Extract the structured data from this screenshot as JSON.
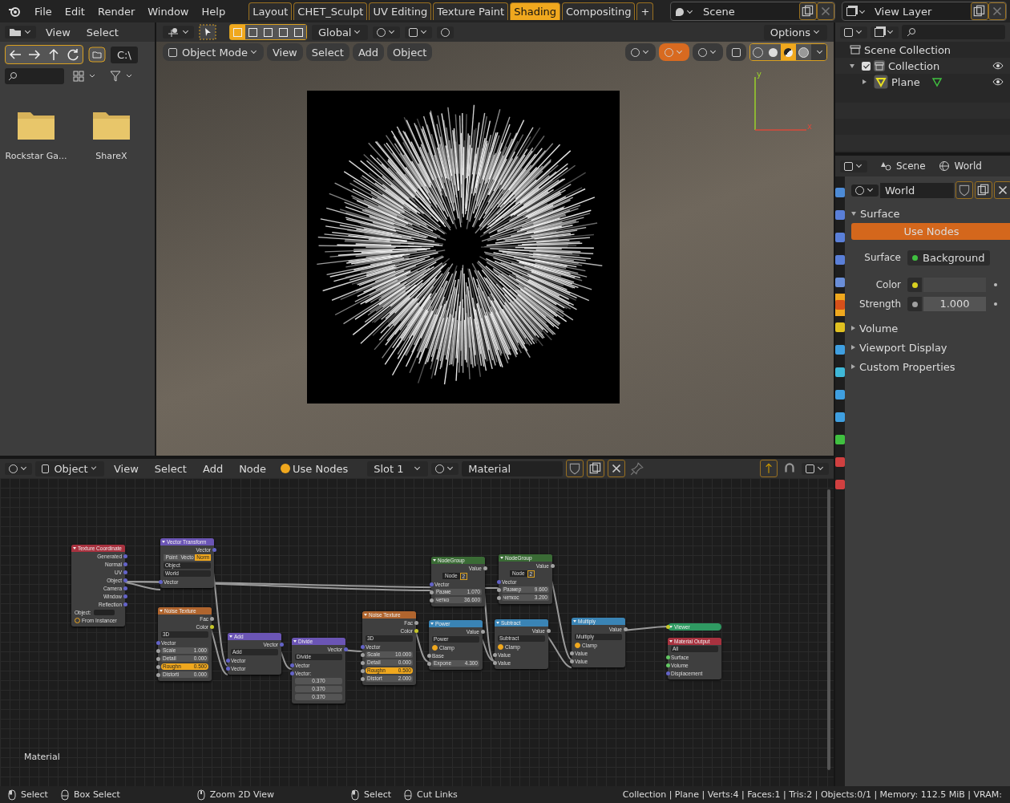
{
  "topbar": {
    "menus": [
      "File",
      "Edit",
      "Render",
      "Window",
      "Help"
    ],
    "workspaces": [
      {
        "label": "Layout",
        "selected": false
      },
      {
        "label": "CHET_Sculpt",
        "selected": false
      },
      {
        "label": "UV Editing",
        "selected": false
      },
      {
        "label": "Texture Paint",
        "selected": false
      },
      {
        "label": "Shading",
        "selected": true
      },
      {
        "label": "Compositing",
        "selected": false
      }
    ],
    "add_tab": "+",
    "scene": "Scene",
    "view_layer": "View Layer"
  },
  "file_browser": {
    "menus": [
      "View",
      "Select"
    ],
    "path": "C:\\",
    "items": [
      "Rockstar Ga...",
      "ShareX"
    ]
  },
  "viewport": {
    "orientation": "Global",
    "options": "Options",
    "mode": "Object Mode",
    "menus": [
      "View",
      "Select",
      "Add",
      "Object"
    ],
    "select_modes": [
      {
        "selected": true
      },
      {
        "selected": false
      },
      {
        "selected": false
      },
      {
        "selected": false
      },
      {
        "selected": false
      }
    ],
    "shading_modes": [
      {
        "selected": false
      },
      {
        "selected": false
      },
      {
        "selected": true
      },
      {
        "selected": false
      }
    ],
    "axes": [
      "y",
      "x"
    ]
  },
  "outliner": {
    "root": "Scene Collection",
    "children": [
      {
        "label": "Collection",
        "checked": true,
        "expanded": true,
        "children": [
          {
            "label": "Plane",
            "expanded": false
          }
        ]
      }
    ]
  },
  "properties": {
    "context": [
      "Scene",
      "World"
    ],
    "tabs": [
      {
        "selected": false
      },
      {
        "selected": false
      },
      {
        "selected": false
      },
      {
        "selected": false
      },
      {
        "selected": false
      },
      {
        "selected": true
      },
      {
        "selected": false
      },
      {
        "selected": false
      },
      {
        "selected": false
      },
      {
        "selected": false
      },
      {
        "selected": false
      },
      {
        "selected": false
      },
      {
        "selected": false
      },
      {
        "selected": false
      }
    ],
    "world": "World",
    "panels": [
      {
        "title": "Surface",
        "expanded": true,
        "use_nodes": "Use Nodes",
        "fields": [
          {
            "label": "Surface",
            "kind": "shader",
            "value": "Background"
          },
          {
            "label": "Color",
            "kind": "color"
          },
          {
            "label": "Strength",
            "kind": "number",
            "value": "1.000"
          }
        ]
      },
      {
        "title": "Volume",
        "expanded": false
      },
      {
        "title": "Viewport Display",
        "expanded": false
      },
      {
        "title": "Custom Properties",
        "expanded": false
      }
    ]
  },
  "node_editor": {
    "type": "Object",
    "menus": [
      "View",
      "Select",
      "Add",
      "Node"
    ],
    "use_nodes": {
      "label": "Use Nodes",
      "checked": true
    },
    "slot": "Slot 1",
    "material": "Material",
    "overlay_label": "Material",
    "nodes": [
      {
        "title": "Texture Coordinate",
        "color": "#a8323f",
        "rows": [
          {
            "kind": "output",
            "label": "Generated",
            "color": "#6363c7"
          },
          {
            "kind": "output",
            "label": "Normal",
            "color": "#6363c7"
          },
          {
            "kind": "output",
            "label": "UV",
            "color": "#6363c7"
          },
          {
            "kind": "output",
            "label": "Object",
            "color": "#6363c7"
          },
          {
            "kind": "output",
            "label": "Camera",
            "color": "#6363c7"
          },
          {
            "kind": "output",
            "label": "Window",
            "color": "#6363c7"
          },
          {
            "kind": "output",
            "label": "Reflection",
            "color": "#6363c7"
          },
          {
            "kind": "object",
            "label": "Object:"
          },
          {
            "kind": "toggle",
            "label": "From Instancer",
            "checked": false
          }
        ]
      },
      {
        "title": "Vector Transform",
        "color": "#6b55b5",
        "rows": [
          {
            "kind": "output",
            "label": "Vector",
            "color": "#6363c7"
          },
          {
            "kind": "segmented",
            "options": [
              {
                "label": "Point",
                "selected": false
              },
              {
                "label": "Vecto",
                "selected": false
              },
              {
                "label": "Norm",
                "selected": true
              }
            ]
          },
          {
            "kind": "select",
            "value": "Object"
          },
          {
            "kind": "select",
            "value": "World"
          },
          {
            "kind": "input",
            "label": "Vector",
            "color": "#6363c7"
          }
        ]
      },
      {
        "title": "Noise Texture",
        "color": "#b0652e",
        "rows": [
          {
            "kind": "output",
            "label": "Fac",
            "color": "#a1a1a1"
          },
          {
            "kind": "output",
            "label": "Color",
            "color": "#c7c729"
          },
          {
            "kind": "select",
            "value": "3D"
          },
          {
            "kind": "input",
            "label": "Vector",
            "color": "#6363c7"
          },
          {
            "kind": "field",
            "label": "Scale",
            "value": "1.000",
            "active": false
          },
          {
            "kind": "field",
            "label": "Detail",
            "value": "0.000",
            "active": false
          },
          {
            "kind": "field",
            "label": "Roughn",
            "value": "0.500",
            "active": true
          },
          {
            "kind": "field",
            "label": "Distorti",
            "value": "0.000",
            "active": false
          }
        ]
      },
      {
        "title": "Add",
        "color": "#6b55b5",
        "rows": [
          {
            "kind": "output",
            "label": "Vector",
            "color": "#6363c7"
          },
          {
            "kind": "select",
            "value": "Add"
          },
          {
            "kind": "input",
            "label": "Vector",
            "color": "#6363c7"
          },
          {
            "kind": "input",
            "label": "Vector",
            "color": "#6363c7"
          }
        ]
      },
      {
        "title": "Divide",
        "color": "#6b55b5",
        "rows": [
          {
            "kind": "output",
            "label": "Vector",
            "color": "#6363c7"
          },
          {
            "kind": "select",
            "value": "Divide"
          },
          {
            "kind": "input",
            "label": "Vector",
            "color": "#6363c7"
          },
          {
            "kind": "input",
            "label": "Vector:",
            "color": "#6363c7"
          },
          {
            "kind": "value",
            "value": "0.370"
          },
          {
            "kind": "value",
            "value": "0.370"
          },
          {
            "kind": "value",
            "value": "0.370"
          }
        ]
      },
      {
        "title": "Noise Texture",
        "color": "#b0652e",
        "rows": [
          {
            "kind": "output",
            "label": "Fac",
            "color": "#a1a1a1"
          },
          {
            "kind": "output",
            "label": "Color",
            "color": "#c7c729"
          },
          {
            "kind": "select",
            "value": "3D"
          },
          {
            "kind": "input",
            "label": "Vector",
            "color": "#6363c7"
          },
          {
            "kind": "field",
            "label": "Scale",
            "value": "10.000",
            "active": false
          },
          {
            "kind": "field",
            "label": "Detail",
            "value": "0.000",
            "active": false
          },
          {
            "kind": "field",
            "label": "Roughn",
            "value": "0.500",
            "active": true
          },
          {
            "kind": "field",
            "label": "Distort",
            "value": "2.000",
            "active": false
          }
        ]
      },
      {
        "title": "NodeGroup",
        "color": "#3a6b35",
        "rows": [
          {
            "kind": "output",
            "label": "Value",
            "color": "#a1a1a1"
          },
          {
            "kind": "group",
            "value": "Node",
            "users": "2"
          },
          {
            "kind": "input",
            "label": "Vector",
            "color": "#6363c7"
          },
          {
            "kind": "field",
            "label": "Разме",
            "value": "1.070",
            "active": false
          },
          {
            "kind": "field",
            "label": "четко",
            "value": "36.600",
            "active": false
          }
        ]
      },
      {
        "title": "NodeGroup",
        "color": "#3a6b35",
        "rows": [
          {
            "kind": "output",
            "label": "Value",
            "color": "#a1a1a1"
          },
          {
            "kind": "group",
            "value": "Node",
            "users": "2"
          },
          {
            "kind": "input",
            "label": "Vector",
            "color": "#6363c7"
          },
          {
            "kind": "field",
            "label": "Размер",
            "value": "9.600",
            "active": false
          },
          {
            "kind": "field",
            "label": "четкос",
            "value": "3.200",
            "active": false
          }
        ]
      },
      {
        "title": "Power",
        "color": "#3a84b5",
        "rows": [
          {
            "kind": "output",
            "label": "Value",
            "color": "#a1a1a1"
          },
          {
            "kind": "select",
            "value": "Power"
          },
          {
            "kind": "toggle",
            "label": "Clamp",
            "checked": true
          },
          {
            "kind": "input",
            "label": "Base",
            "color": "#a1a1a1"
          },
          {
            "kind": "field",
            "label": "Expone",
            "value": "4.300",
            "active": false
          }
        ]
      },
      {
        "title": "Subtract",
        "color": "#3a84b5",
        "rows": [
          {
            "kind": "output",
            "label": "Value",
            "color": "#a1a1a1"
          },
          {
            "kind": "select",
            "value": "Subtract"
          },
          {
            "kind": "toggle",
            "label": "Clamp",
            "checked": true
          },
          {
            "kind": "input",
            "label": "Value",
            "color": "#a1a1a1"
          },
          {
            "kind": "input",
            "label": "Value",
            "color": "#a1a1a1"
          }
        ]
      },
      {
        "title": "Multiply",
        "color": "#3a84b5",
        "rows": [
          {
            "kind": "output",
            "label": "Value",
            "color": "#a1a1a1"
          },
          {
            "kind": "select",
            "value": "Multiply"
          },
          {
            "kind": "toggle",
            "label": "Clamp",
            "checked": true
          },
          {
            "kind": "input",
            "label": "Value",
            "color": "#a1a1a1"
          },
          {
            "kind": "input",
            "label": "Value",
            "color": "#a1a1a1"
          }
        ]
      },
      {
        "title": "Viewer",
        "color": "#2f9a62"
      },
      {
        "title": "Material Output",
        "color": "#a8323f",
        "rows": [
          {
            "kind": "select",
            "value": "All"
          },
          {
            "kind": "input",
            "label": "Surface",
            "color": "#63c763"
          },
          {
            "kind": "input",
            "label": "Volume",
            "color": "#63c763"
          },
          {
            "kind": "input",
            "label": "Displacement",
            "color": "#6363c7"
          }
        ]
      }
    ]
  },
  "status_bar": {
    "hints": [
      {
        "kind": "left",
        "label": "Select"
      },
      {
        "kind": "drag",
        "label": "Box Select"
      },
      {
        "kind": "middle",
        "label": "Zoom 2D View"
      },
      {
        "kind": "left",
        "label": "Select"
      },
      {
        "kind": "drag",
        "label": "Cut Links"
      }
    ],
    "stats": "Collection | Plane | Verts:4 | Faces:1 | Tris:2 | Objects:0/1 | Memory: 112.5 MiB | VRAM:"
  }
}
